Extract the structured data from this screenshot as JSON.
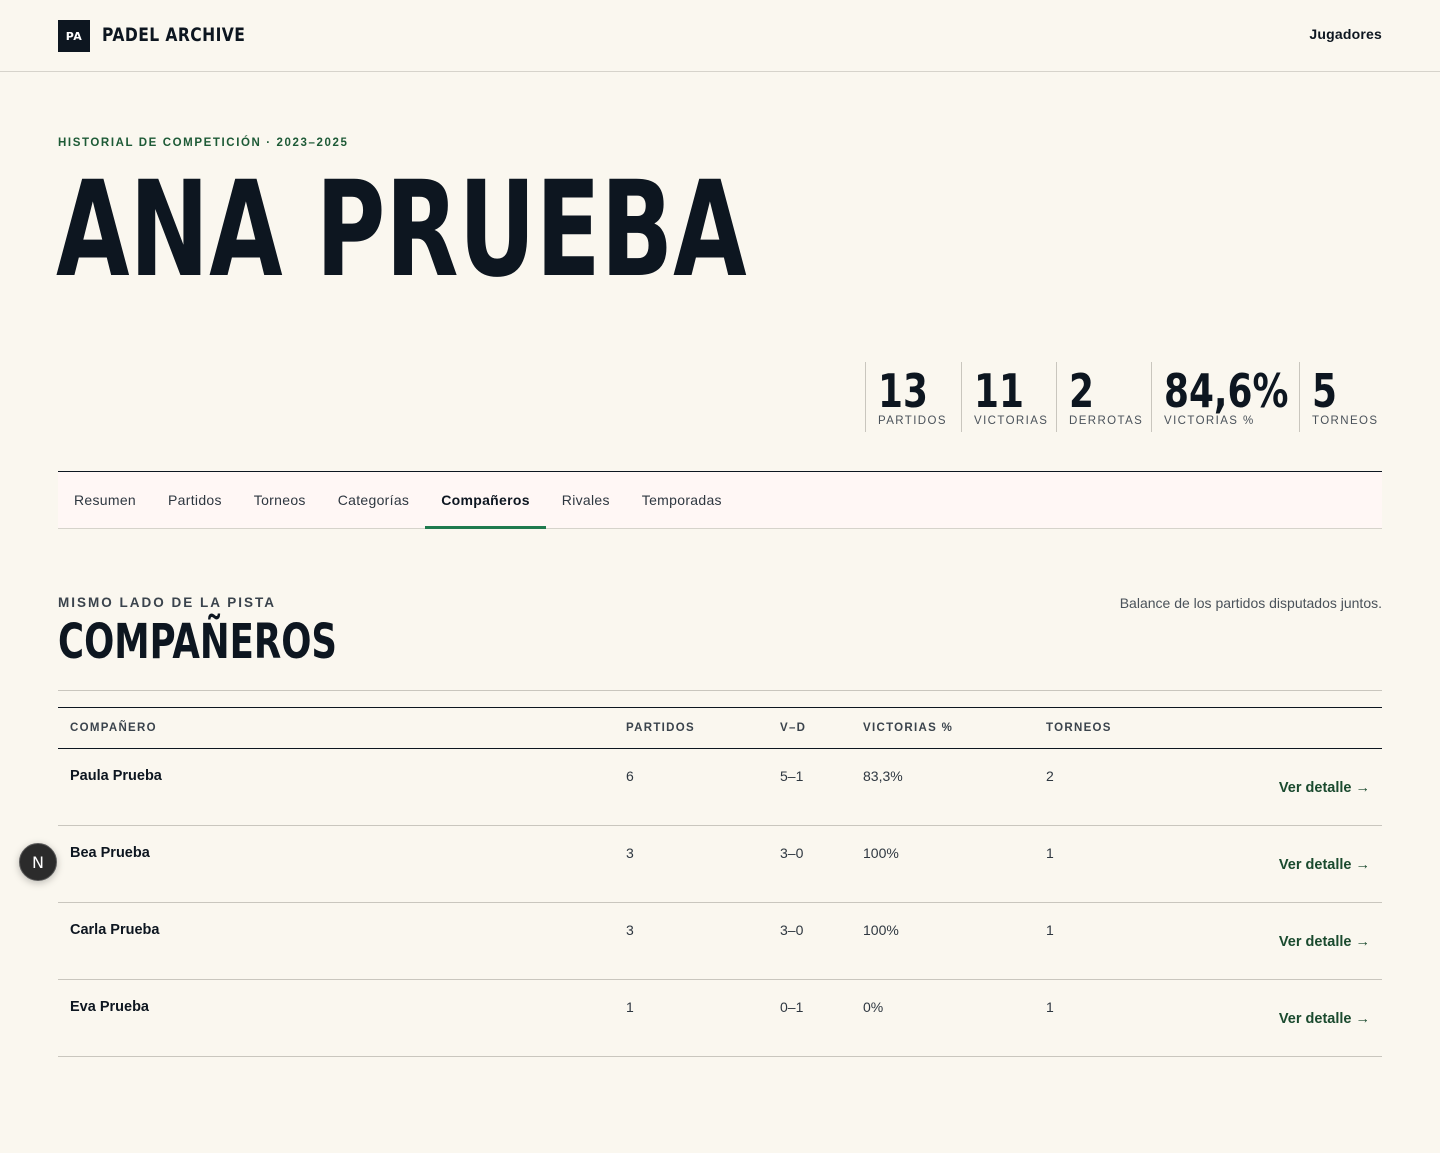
{
  "header": {
    "logo_mark": "PA",
    "logo_text": "PADEL ARCHIVE",
    "nav_link": "Jugadores"
  },
  "hero": {
    "eyebrow": "HISTORIAL DE COMPETICIÓN · 2023–2025",
    "name": "ANA PRUEBA"
  },
  "stats": [
    {
      "value": "13",
      "label": "PARTIDOS"
    },
    {
      "value": "11",
      "label": "VICTORIAS"
    },
    {
      "value": "2",
      "label": "DERROTAS"
    },
    {
      "value": "84,6%",
      "label": "VICTORIAS %"
    },
    {
      "value": "5",
      "label": "TORNEOS"
    }
  ],
  "tabs": [
    {
      "label": "Resumen",
      "active": false
    },
    {
      "label": "Partidos",
      "active": false
    },
    {
      "label": "Torneos",
      "active": false
    },
    {
      "label": "Categorías",
      "active": false
    },
    {
      "label": "Compañeros",
      "active": true
    },
    {
      "label": "Rivales",
      "active": false
    },
    {
      "label": "Temporadas",
      "active": false
    }
  ],
  "section": {
    "eyebrow": "MISMO LADO DE LA PISTA",
    "title": "COMPAÑEROS",
    "description": "Balance de los partidos disputados juntos."
  },
  "table": {
    "headers": [
      "COMPAÑERO",
      "PARTIDOS",
      "V–D",
      "VICTORIAS %",
      "TORNEOS"
    ],
    "rows": [
      {
        "name": "Paula Prueba",
        "matches": "6",
        "wl": "5–1",
        "pct": "83,3%",
        "tournaments": "2",
        "link": "Ver detalle →"
      },
      {
        "name": "Bea Prueba",
        "matches": "3",
        "wl": "3–0",
        "pct": "100%",
        "tournaments": "1",
        "link": "Ver detalle →"
      },
      {
        "name": "Carla Prueba",
        "matches": "3",
        "wl": "3–0",
        "pct": "100%",
        "tournaments": "1",
        "link": "Ver detalle →"
      },
      {
        "name": "Eva Prueba",
        "matches": "1",
        "wl": "0–1",
        "pct": "0%",
        "tournaments": "1",
        "link": "Ver detalle →"
      }
    ]
  },
  "floating_badge": {
    "label": "N",
    "icon": "nextjs-icon"
  },
  "colors": {
    "background": "#faf7ef",
    "ink": "#0d1620",
    "accent_green": "#1f7a4e",
    "eyebrow_green": "#1d5a36",
    "link_green": "#1a4a2e",
    "tabs_bg": "#fff7f5"
  }
}
